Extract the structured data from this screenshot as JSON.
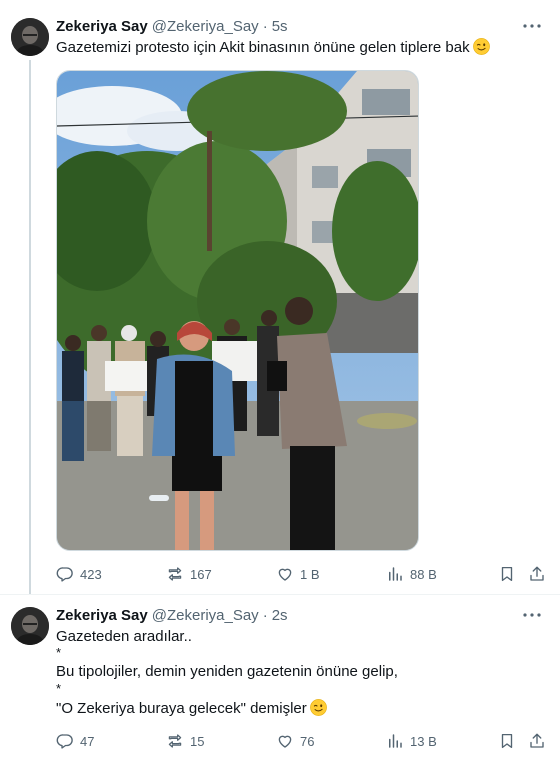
{
  "tweets": [
    {
      "author": {
        "name": "Zekeriya Say",
        "handle": "@Zekeriya_Say"
      },
      "separator": "·",
      "time": "5s",
      "text": "Gazetemizi protesto için Akit binasının önüne gelen tiplere bak",
      "emoji": "winking-face-icon",
      "actions": {
        "replies": "423",
        "reposts": "167",
        "likes": "1 B",
        "views": "88 B"
      }
    },
    {
      "author": {
        "name": "Zekeriya Say",
        "handle": "@Zekeriya_Say"
      },
      "separator": "·",
      "time": "2s",
      "lines": [
        "Gazeteden aradılar..",
        "*",
        "Bu tipolojiler, demin yeniden gazetenin önüne gelip,",
        "*",
        "\"O Zekeriya buraya gelecek\" demişler"
      ],
      "emoji": "winking-face-icon",
      "actions": {
        "replies": "47",
        "reposts": "15",
        "likes": "76",
        "views": "13 B"
      }
    }
  ],
  "colors": {
    "text": "#0f1419",
    "secondary": "#536471",
    "thread_line": "#cfd9de",
    "divider": "#eff3f4"
  }
}
